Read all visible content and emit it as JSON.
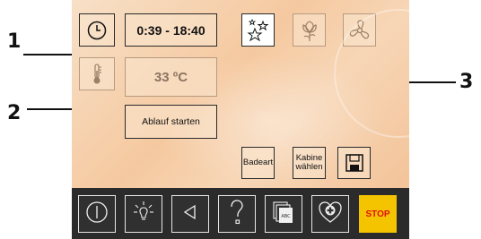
{
  "panel": {
    "time_range": "0:39 - 18:40",
    "temperature": "33 ºC",
    "start_label": "Ablauf starten",
    "bath_type_label": "Badeart",
    "cabin_label": "Kabine\nwählen"
  },
  "callouts": {
    "one": "1",
    "two": "2",
    "three": "3"
  },
  "bottom_bar": {
    "stop_label": "STOP"
  },
  "colors": {
    "panel_bg": "#f5c9a0",
    "bar_bg": "#2b2b2b",
    "stop_bg": "#f5c400",
    "stop_text": "#e01010"
  },
  "icons": [
    "clock-icon",
    "thermometer-icon",
    "sparkle-icon",
    "flower-icon",
    "fan-icon",
    "save-icon",
    "power-icon",
    "light-icon",
    "back-icon",
    "help-icon",
    "text-library-icon",
    "health-heart-icon"
  ]
}
